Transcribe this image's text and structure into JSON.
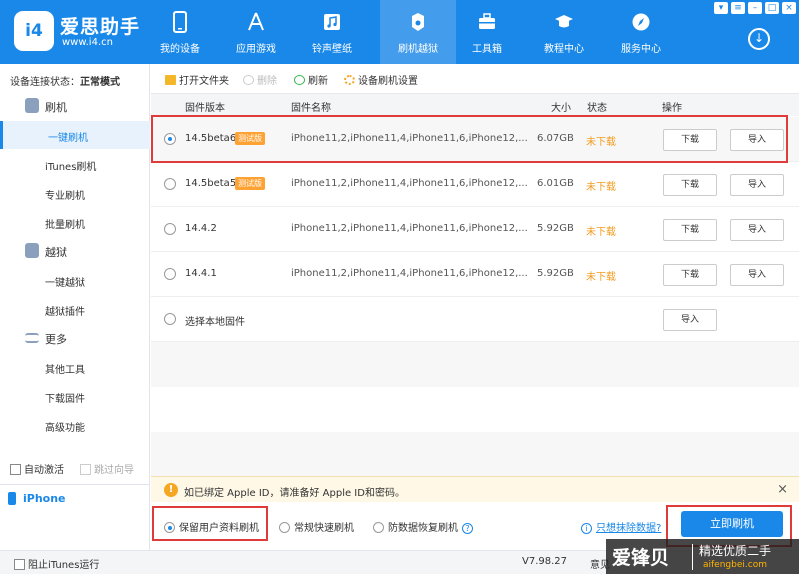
{
  "app": {
    "name": "爱思助手",
    "url": "www.i4.cn",
    "logo": "i4"
  },
  "nav": [
    {
      "label": "我的设备",
      "icon": "phone-icon"
    },
    {
      "label": "应用游戏",
      "icon": "app-store-icon"
    },
    {
      "label": "铃声壁纸",
      "icon": "music-icon"
    },
    {
      "label": "刷机越狱",
      "icon": "box-icon"
    },
    {
      "label": "工具箱",
      "icon": "toolbox-icon"
    },
    {
      "label": "教程中心",
      "icon": "graduation-cap-icon"
    },
    {
      "label": "服务中心",
      "icon": "compass-icon"
    }
  ],
  "sidebar": {
    "conn_label": "设备连接状态：",
    "conn_value": "正常模式",
    "sections": [
      {
        "label": "刷机",
        "items": [
          "一键刷机",
          "iTunes刷机",
          "专业刷机",
          "批量刷机"
        ]
      },
      {
        "label": "越狱",
        "items": [
          "一键越狱",
          "越狱插件"
        ]
      },
      {
        "label": "更多",
        "items": [
          "其他工具",
          "下载固件",
          "高级功能"
        ]
      }
    ],
    "auto_activate": "自动激活",
    "skip_guide": "跳过向导",
    "device": "iPhone"
  },
  "toolbar": {
    "open_folder": "打开文件夹",
    "delete": "删除",
    "refresh": "刷新",
    "settings": "设备刷机设置"
  },
  "table": {
    "headers": {
      "version": "固件版本",
      "name": "固件名称",
      "size": "大小",
      "status": "状态",
      "action": "操作"
    },
    "rows": [
      {
        "version": "14.5beta6",
        "badge": "测试版",
        "name": "iPhone11,2,iPhone11,4,iPhone11,6,iPhone12,...",
        "size": "6.07GB",
        "status": "未下载",
        "download": "下载",
        "import": "导入"
      },
      {
        "version": "14.5beta5",
        "badge": "测试版",
        "name": "iPhone11,2,iPhone11,4,iPhone11,6,iPhone12,...",
        "size": "6.01GB",
        "status": "未下载",
        "download": "下载",
        "import": "导入"
      },
      {
        "version": "14.4.2",
        "badge": "",
        "name": "iPhone11,2,iPhone11,4,iPhone11,6,iPhone12,...",
        "size": "5.92GB",
        "status": "未下载",
        "download": "下载",
        "import": "导入"
      },
      {
        "version": "14.4.1",
        "badge": "",
        "name": "iPhone11,2,iPhone11,4,iPhone11,6,iPhone12,...",
        "size": "5.92GB",
        "status": "未下载",
        "download": "下载",
        "import": "导入"
      }
    ],
    "local": {
      "label": "选择本地固件",
      "import": "导入"
    }
  },
  "notice": {
    "text": "如已绑定 Apple ID，请准备好 Apple ID和密码。",
    "close": "×"
  },
  "options": {
    "keep_data": "保留用户资料刷机",
    "fast": "常规快速刷机",
    "recovery": "防数据恢复刷机",
    "help": "?",
    "erase_link": "只想抹除数据?",
    "flash_button": "立即刷机"
  },
  "status_bar": {
    "block_itunes": "阻止iTunes运行",
    "version": "V7.98.27",
    "feedback": "意见"
  },
  "watermark": {
    "brand": "爱锋贝",
    "slogan": "精选优质二手",
    "url": "aifengbei.com"
  },
  "colors": {
    "primary": "#1a88e8",
    "warning": "#f29b1c",
    "highlight_box": "#e03b3b"
  }
}
